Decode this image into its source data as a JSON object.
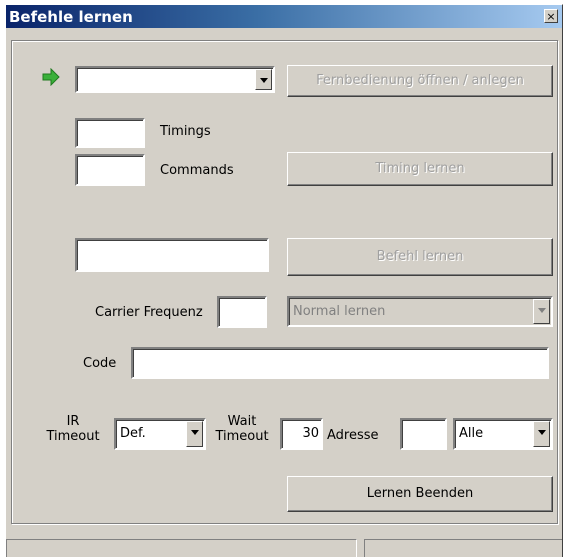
{
  "window": {
    "title": "Befehle lernen",
    "close_glyph": "×"
  },
  "remote": {
    "selected": "",
    "open_button": "Fernbedienung öffnen / anlegen"
  },
  "timing": {
    "timings_label": "Timings",
    "timings_value": "",
    "commands_label": "Commands",
    "commands_value": "",
    "learn_button": "Timing lernen"
  },
  "command": {
    "name_value": "",
    "learn_button": "Befehl lernen"
  },
  "carrier": {
    "label": "Carrier Frequenz",
    "value": "",
    "mode_selected": "Normal lernen"
  },
  "code": {
    "label": "Code",
    "value": ""
  },
  "options": {
    "ir_timeout_label_line1": "IR",
    "ir_timeout_label_line2": "Timeout",
    "ir_timeout_selected": "Def.",
    "wait_timeout_label_line1": "Wait",
    "wait_timeout_label_line2": "Timeout",
    "wait_timeout_value": "30",
    "adresse_label": "Adresse",
    "adresse_value": "",
    "adresse_selected": "Alle"
  },
  "footer": {
    "finish_button": "Lernen Beenden"
  },
  "icons": {
    "status_arrow": "green-arrow-icon",
    "status_arrow_color": "#3ab03a"
  }
}
